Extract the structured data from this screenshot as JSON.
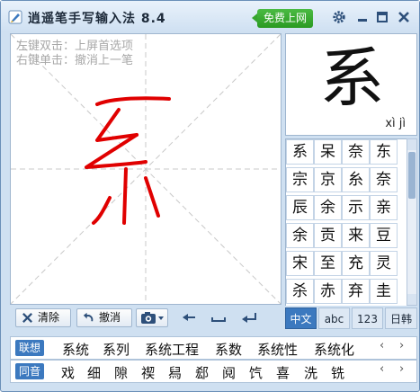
{
  "title_bar": {
    "title": "逍遥笔手写输入法 8.4",
    "online_button": "免费上网",
    "icons": [
      "app-icon",
      "gear-icon",
      "minimize-icon",
      "maximize-icon",
      "close-icon"
    ]
  },
  "pad": {
    "hint_line1": "左键双击：上屏首选项",
    "hint_line2": "右键单击：撤消上一笔",
    "stroke_color": "#e00000"
  },
  "preview": {
    "character": "系",
    "pinyin": "xì jì"
  },
  "candidates": [
    "系",
    "呆",
    "奈",
    "东",
    "宗",
    "京",
    "糸",
    "奈",
    "辰",
    "余",
    "示",
    "亲",
    "余",
    "贡",
    "来",
    "豆",
    "宋",
    "至",
    "充",
    "灵",
    "杀",
    "赤",
    "弃",
    "圭"
  ],
  "modes": {
    "zh": "中文",
    "abc": "abc",
    "num": "123",
    "kr": "日韩"
  },
  "toolbar": {
    "clear": "清除",
    "undo": "撤消",
    "icons": [
      "camera-icon",
      "chevron-down-icon",
      "backspace-icon",
      "space-icon",
      "enter-icon"
    ]
  },
  "association": {
    "label": "联想",
    "words": [
      "系统",
      "系列",
      "系统工程",
      "系数",
      "系统性",
      "系统化"
    ]
  },
  "homophones": {
    "label": "同音",
    "chars": [
      "戏",
      "细",
      "隙",
      "禊",
      "舄",
      "郄",
      "阋",
      "饩",
      "喜",
      "洗",
      "铣"
    ]
  },
  "colors": {
    "accent": "#3c79bf",
    "online": "#2a9a22",
    "frame": "#cfe0f1"
  }
}
